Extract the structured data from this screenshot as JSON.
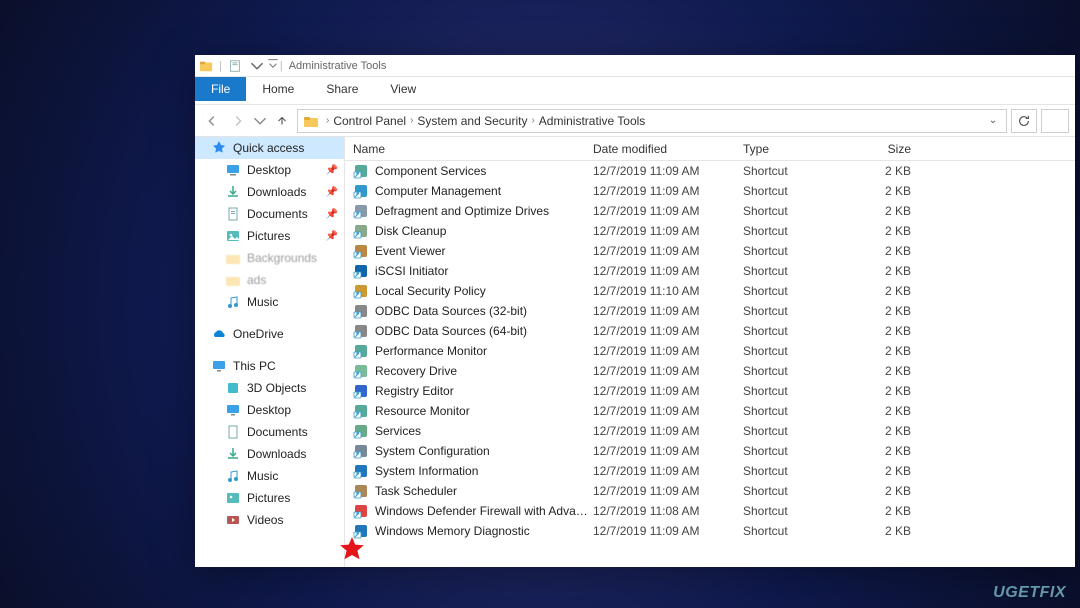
{
  "window": {
    "title": "Administrative Tools"
  },
  "ribbon": {
    "file": "File",
    "home": "Home",
    "share": "Share",
    "view": "View"
  },
  "breadcrumbs": [
    "Control Panel",
    "System and Security",
    "Administrative Tools"
  ],
  "columns": {
    "name": "Name",
    "date": "Date modified",
    "type": "Type",
    "size": "Size"
  },
  "sidebar": {
    "quick_access": "Quick access",
    "pinned": [
      {
        "label": "Desktop"
      },
      {
        "label": "Downloads"
      },
      {
        "label": "Documents"
      },
      {
        "label": "Pictures"
      }
    ],
    "recent_dim1": "Backgrounds",
    "recent_dim2": "ads",
    "recent_music": "Music",
    "onedrive": "OneDrive",
    "this_pc": "This PC",
    "this_pc_children": [
      "3D Objects",
      "Desktop",
      "Documents",
      "Downloads",
      "Music",
      "Pictures",
      "Videos"
    ]
  },
  "files": [
    {
      "name": "Component Services",
      "date": "12/7/2019 11:09 AM",
      "type": "Shortcut",
      "size": "2 KB",
      "icon": "component"
    },
    {
      "name": "Computer Management",
      "date": "12/7/2019 11:09 AM",
      "type": "Shortcut",
      "size": "2 KB",
      "icon": "pc"
    },
    {
      "name": "Defragment and Optimize Drives",
      "date": "12/7/2019 11:09 AM",
      "type": "Shortcut",
      "size": "2 KB",
      "icon": "defrag"
    },
    {
      "name": "Disk Cleanup",
      "date": "12/7/2019 11:09 AM",
      "type": "Shortcut",
      "size": "2 KB",
      "icon": "disk"
    },
    {
      "name": "Event Viewer",
      "date": "12/7/2019 11:09 AM",
      "type": "Shortcut",
      "size": "2 KB",
      "icon": "event"
    },
    {
      "name": "iSCSI Initiator",
      "date": "12/7/2019 11:09 AM",
      "type": "Shortcut",
      "size": "2 KB",
      "icon": "iscsi"
    },
    {
      "name": "Local Security Policy",
      "date": "12/7/2019 11:10 AM",
      "type": "Shortcut",
      "size": "2 KB",
      "icon": "security"
    },
    {
      "name": "ODBC Data Sources (32-bit)",
      "date": "12/7/2019 11:09 AM",
      "type": "Shortcut",
      "size": "2 KB",
      "icon": "odbc"
    },
    {
      "name": "ODBC Data Sources (64-bit)",
      "date": "12/7/2019 11:09 AM",
      "type": "Shortcut",
      "size": "2 KB",
      "icon": "odbc"
    },
    {
      "name": "Performance Monitor",
      "date": "12/7/2019 11:09 AM",
      "type": "Shortcut",
      "size": "2 KB",
      "icon": "perf"
    },
    {
      "name": "Recovery Drive",
      "date": "12/7/2019 11:09 AM",
      "type": "Shortcut",
      "size": "2 KB",
      "icon": "recovery"
    },
    {
      "name": "Registry Editor",
      "date": "12/7/2019 11:09 AM",
      "type": "Shortcut",
      "size": "2 KB",
      "icon": "regedit"
    },
    {
      "name": "Resource Monitor",
      "date": "12/7/2019 11:09 AM",
      "type": "Shortcut",
      "size": "2 KB",
      "icon": "resmon"
    },
    {
      "name": "Services",
      "date": "12/7/2019 11:09 AM",
      "type": "Shortcut",
      "size": "2 KB",
      "icon": "services"
    },
    {
      "name": "System Configuration",
      "date": "12/7/2019 11:09 AM",
      "type": "Shortcut",
      "size": "2 KB",
      "icon": "msconfig"
    },
    {
      "name": "System Information",
      "date": "12/7/2019 11:09 AM",
      "type": "Shortcut",
      "size": "2 KB",
      "icon": "sysinfo"
    },
    {
      "name": "Task Scheduler",
      "date": "12/7/2019 11:09 AM",
      "type": "Shortcut",
      "size": "2 KB",
      "icon": "tasksched"
    },
    {
      "name": "Windows Defender Firewall with Advanc...",
      "date": "12/7/2019 11:08 AM",
      "type": "Shortcut",
      "size": "2 KB",
      "icon": "firewall"
    },
    {
      "name": "Windows Memory Diagnostic",
      "date": "12/7/2019 11:09 AM",
      "type": "Shortcut",
      "size": "2 KB",
      "icon": "memdiag"
    }
  ],
  "watermark": "UGETFIX"
}
